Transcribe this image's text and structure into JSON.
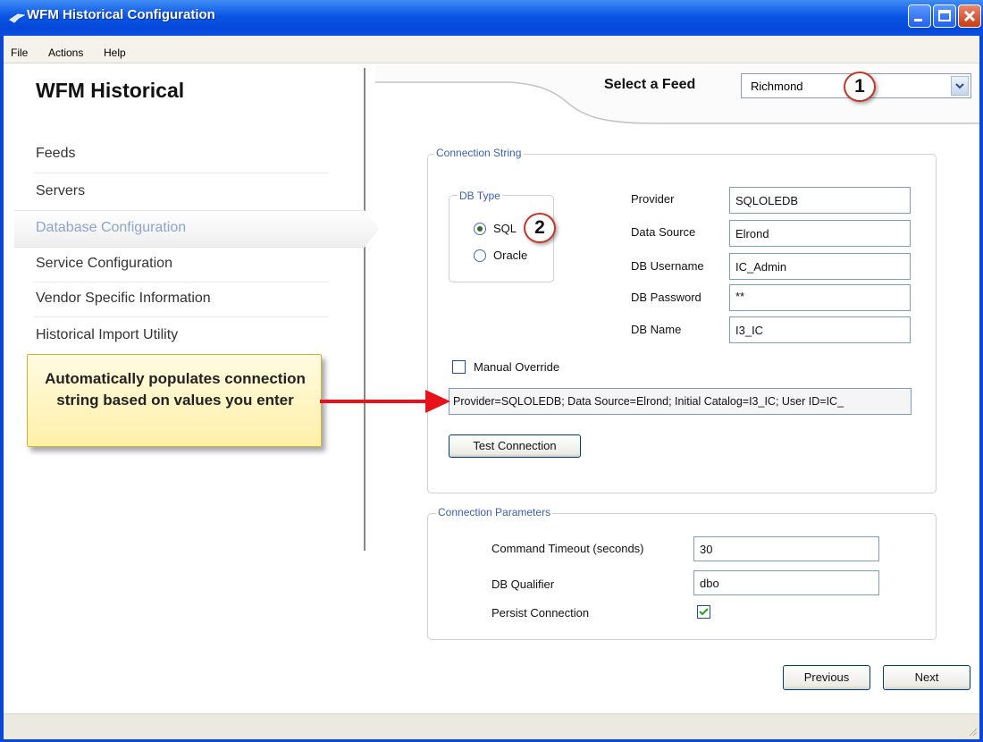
{
  "window": {
    "title": "WFM Historical Configuration"
  },
  "menu": [
    "File",
    "Actions",
    "Help"
  ],
  "app_heading": "WFM Historical",
  "nav": {
    "items": [
      {
        "label": "Feeds"
      },
      {
        "label": "Servers"
      },
      {
        "label": "Database Configuration",
        "active": true
      },
      {
        "label": "Service Configuration"
      },
      {
        "label": "Vendor Specific Information"
      },
      {
        "label": "Historical Import Utility"
      }
    ]
  },
  "feed": {
    "label": "Select a Feed",
    "value": "Richmond"
  },
  "connection_string": {
    "legend": "Connection String",
    "db_type": {
      "legend": "DB Type",
      "options": [
        "SQL",
        "Oracle"
      ],
      "selected": "SQL"
    },
    "fields": [
      {
        "label": "Provider",
        "value": "SQLOLEDB"
      },
      {
        "label": "Data Source",
        "value": "Elrond"
      },
      {
        "label": "DB Username",
        "value": "IC_Admin"
      },
      {
        "label": "DB Password",
        "value": "**"
      },
      {
        "label": "DB Name",
        "value": "I3_IC"
      }
    ],
    "manual_override": {
      "label": "Manual Override",
      "checked": false
    },
    "string_value": "Provider=SQLOLEDB; Data Source=Elrond; Initial Catalog=I3_IC; User ID=IC_",
    "test_button": "Test Connection"
  },
  "connection_parameters": {
    "legend": "Connection Parameters",
    "fields": [
      {
        "label": "Command Timeout (seconds)",
        "value": "30"
      },
      {
        "label": "DB Qualifier",
        "value": "dbo"
      }
    ],
    "persist": {
      "label": "Persist Connection",
      "checked": true
    }
  },
  "buttons": {
    "previous": "Previous",
    "next": "Next"
  },
  "callouts": {
    "badge1": "1",
    "badge2": "2",
    "tooltip": "Automatically populates connection string based on values you enter"
  },
  "colors": {
    "titlebar": "#0a55e6",
    "nav_active": "#8ea4c8",
    "legend": "#3b5fb0",
    "arrow": "#e8121a"
  }
}
